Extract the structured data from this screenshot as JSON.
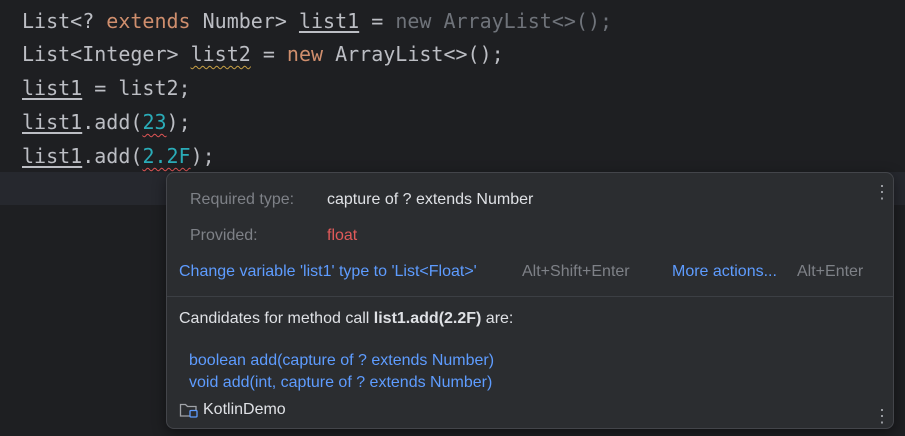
{
  "editor": {
    "lines": [
      {
        "segments": [
          {
            "text": "List<? ",
            "style": "plain"
          },
          {
            "text": "extends",
            "style": "kw"
          },
          {
            "text": " Number> ",
            "style": "plain"
          },
          {
            "text": "list1",
            "style": "u-ref"
          },
          {
            "text": " = ",
            "style": "plain"
          },
          {
            "text": "new ArrayList<>();",
            "style": "dim"
          }
        ]
      },
      {
        "segments": [
          {
            "text": "List<Integer> ",
            "style": "plain"
          },
          {
            "text": "list2",
            "style": "u-warn"
          },
          {
            "text": " = ",
            "style": "plain"
          },
          {
            "text": "new",
            "style": "kw"
          },
          {
            "text": " ArrayList<>();",
            "style": "plain"
          }
        ]
      },
      {
        "segments": [
          {
            "text": "list1",
            "style": "u-ref"
          },
          {
            "text": " = list2;",
            "style": "plain"
          }
        ]
      },
      {
        "segments": [
          {
            "text": "list1",
            "style": "u-ref"
          },
          {
            "text": ".add(",
            "style": "plain"
          },
          {
            "text": "23",
            "style": "num u-err"
          },
          {
            "text": ");",
            "style": "plain"
          }
        ]
      },
      {
        "segments": [
          {
            "text": "list1",
            "style": "u-ref"
          },
          {
            "text": ".add(",
            "style": "plain"
          },
          {
            "text": "2.2F",
            "style": "num u-err"
          },
          {
            "text": ");",
            "style": "plain"
          }
        ]
      }
    ]
  },
  "popup": {
    "required_type_label": "Required type:",
    "required_type_value": "capture of ? extends Number",
    "provided_label": "Provided:",
    "provided_value": "float",
    "fix_action": "Change variable 'list1' type to 'List<Float>'",
    "fix_shortcut": "Alt+Shift+Enter",
    "more_actions": "More actions...",
    "more_shortcut": "Alt+Enter",
    "candidates_prefix": "Candidates for method call ",
    "candidates_call": "list1.add(2.2F)",
    "candidates_suffix": " are:",
    "candidates": [
      "boolean add(capture of ? extends Number)",
      "void add(int, capture of ? extends Number)"
    ],
    "module_name": "KotlinDemo",
    "menu_icon": "vertical-ellipsis-icon",
    "module_icon": "module-folder-icon"
  },
  "colors": {
    "background": "#1e1f22",
    "popup_background": "#2b2d30",
    "keyword": "#cf8e6d",
    "number": "#2aacb8",
    "link": "#5e9cff",
    "error": "#e05a5a"
  }
}
